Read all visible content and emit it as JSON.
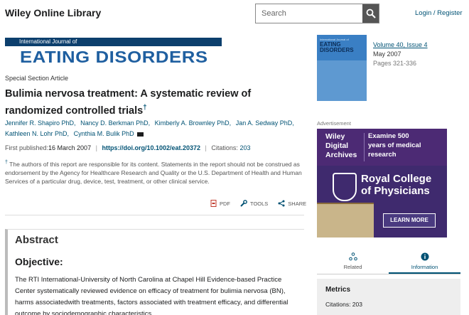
{
  "header": {
    "brand": "Wiley Online Library",
    "search_placeholder": "Search",
    "login_label": "Login / Register"
  },
  "journal": {
    "prefix": "International Journal of",
    "name": "EATING DISORDERS"
  },
  "article": {
    "type": "Special Section Article",
    "title": "Bulimia nervosa treatment: A systematic review of randomized controlled trials",
    "title_mark": "†",
    "authors": [
      "Jennifer R. Shapiro PhD,",
      "Nancy D. Berkman PhD,",
      "Kimberly A. Brownley PhD,",
      "Jan A. Sedway PhD,",
      "Kathleen N. Lohr PhD,",
      "Cynthia M. Bulik PhD"
    ],
    "first_published_label": "First published:",
    "first_published_value": "16 March 2007",
    "doi": "https://doi.org/10.1002/eat.20372",
    "citations_label": "Citations:",
    "citations_value": "203",
    "footnote_mark": "†",
    "footnote": "The authors of this report are responsible for its content. Statements in the report should not be construed as endorsement by the Agency for Healthcare Research and Quality or the U.S. Department of Health and Human Services of a particular drug, device, test, treatment, or other clinical service."
  },
  "tools": {
    "pdf": "PDF",
    "tools": "TOOLS",
    "share": "SHARE"
  },
  "abstract": {
    "heading": "Abstract",
    "objective_heading": "Objective:",
    "objective_text": "The RTI International-University of North Carolina at Chapel Hill Evidence-based Practice Center systematically reviewed evidence on efficacy of treatment for bulimia nervosa (BN), harms associatedwith treatments, factors associated with treatment efficacy, and differential outcome by sociodemographic characteristics."
  },
  "sidebar": {
    "cover": {
      "prefix": "International Journal of",
      "line1": "EATING",
      "line2": "DISORDERS"
    },
    "volume_issue": "Volume 40, Issue 4",
    "date": "May 2007",
    "pages": "Pages 321-336",
    "ad_label": "Advertisement",
    "ad": {
      "wda_line1": "Wiley",
      "wda_line2": "Digital",
      "wda_line3": "Archives",
      "tagline_line1": "Examine 500",
      "tagline_line2": "years of medical",
      "tagline_line3": "research",
      "rcp_line1": "Royal College",
      "rcp_line2": "of Physicians",
      "button": "LEARN MORE"
    },
    "tabs": [
      {
        "label": "Related",
        "active": false
      },
      {
        "label": "Information",
        "active": true
      }
    ],
    "metrics_heading": "Metrics",
    "metrics_citations": "Citations: 203"
  },
  "colors": {
    "link": "#005274",
    "banner_blue": "#1f5fa0",
    "ad_purple": "#3f2a6e"
  }
}
